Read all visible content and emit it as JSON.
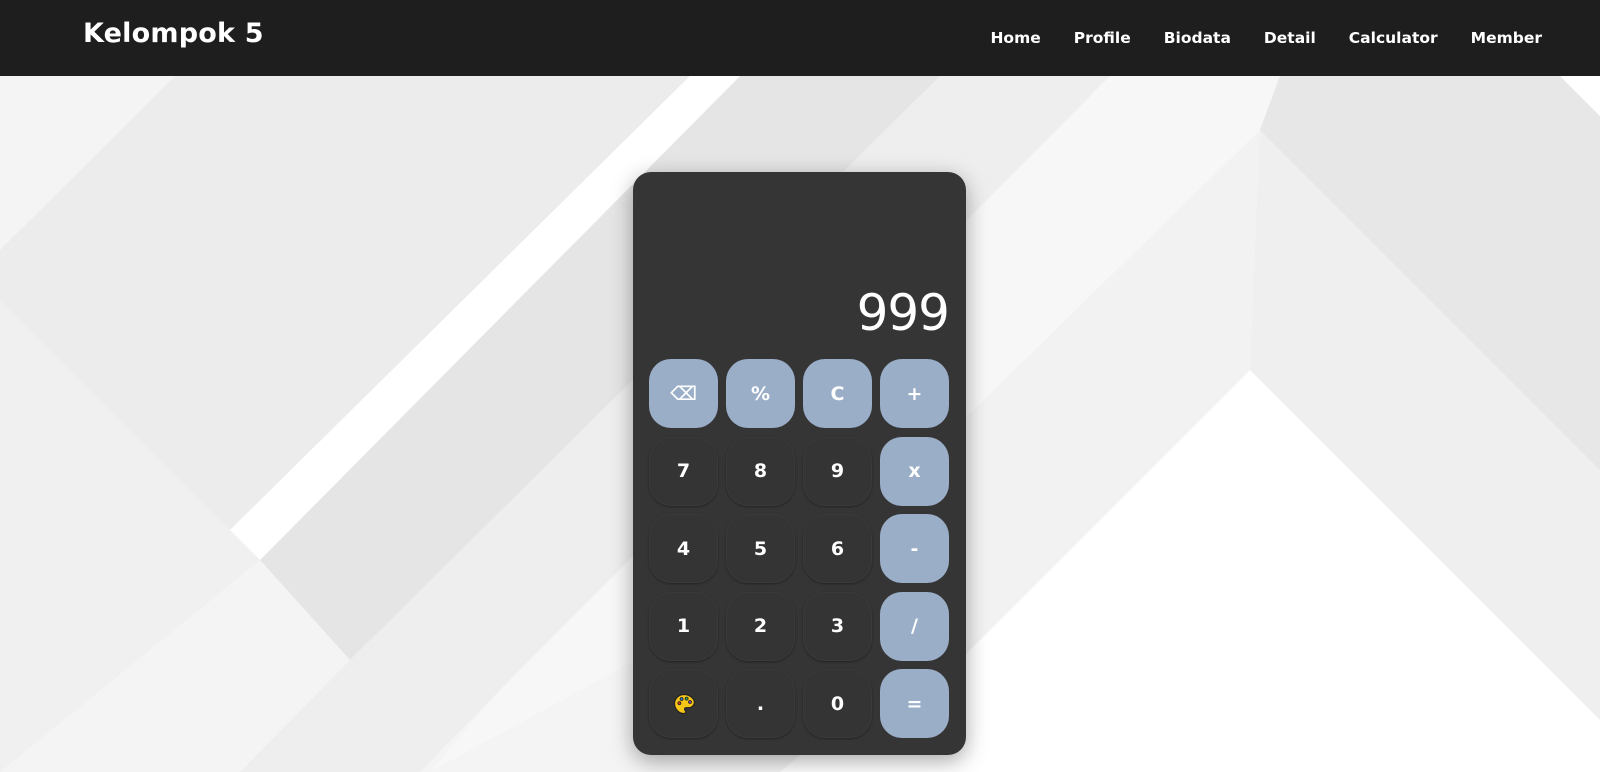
{
  "navbar": {
    "brand": "Kelompok 5",
    "links": [
      "Home",
      "Profile",
      "Biodata",
      "Detail",
      "Calculator",
      "Member"
    ]
  },
  "calculator": {
    "display": "999",
    "keys": [
      {
        "label": "⌫",
        "type": "operator",
        "name": "backspace-button"
      },
      {
        "label": "%",
        "type": "operator",
        "name": "percent-button"
      },
      {
        "label": "C",
        "type": "operator",
        "name": "clear-button"
      },
      {
        "label": "+",
        "type": "operator",
        "name": "add-button"
      },
      {
        "label": "7",
        "type": "number",
        "name": "key-7-button"
      },
      {
        "label": "8",
        "type": "number",
        "name": "key-8-button"
      },
      {
        "label": "9",
        "type": "number",
        "name": "key-9-button"
      },
      {
        "label": "x",
        "type": "operator",
        "name": "multiply-button"
      },
      {
        "label": "4",
        "type": "number",
        "name": "key-4-button"
      },
      {
        "label": "5",
        "type": "number",
        "name": "key-5-button"
      },
      {
        "label": "6",
        "type": "number",
        "name": "key-6-button"
      },
      {
        "label": "-",
        "type": "operator",
        "name": "subtract-button"
      },
      {
        "label": "1",
        "type": "number",
        "name": "key-1-button"
      },
      {
        "label": "2",
        "type": "number",
        "name": "key-2-button"
      },
      {
        "label": "3",
        "type": "number",
        "name": "key-3-button"
      },
      {
        "label": "/",
        "type": "operator",
        "name": "divide-button"
      },
      {
        "label": "",
        "type": "icon",
        "icon": "palette-icon",
        "name": "theme-button"
      },
      {
        "label": ".",
        "type": "number",
        "name": "decimal-button"
      },
      {
        "label": "0",
        "type": "number",
        "name": "key-0-button"
      },
      {
        "label": "=",
        "type": "operator",
        "name": "equals-button"
      }
    ]
  },
  "colors": {
    "navbar_bg": "#1e1e1e",
    "calculator_bg": "#353535",
    "operator_key": "#9aaec8",
    "number_key": "#343434",
    "text": "#ffffff"
  }
}
